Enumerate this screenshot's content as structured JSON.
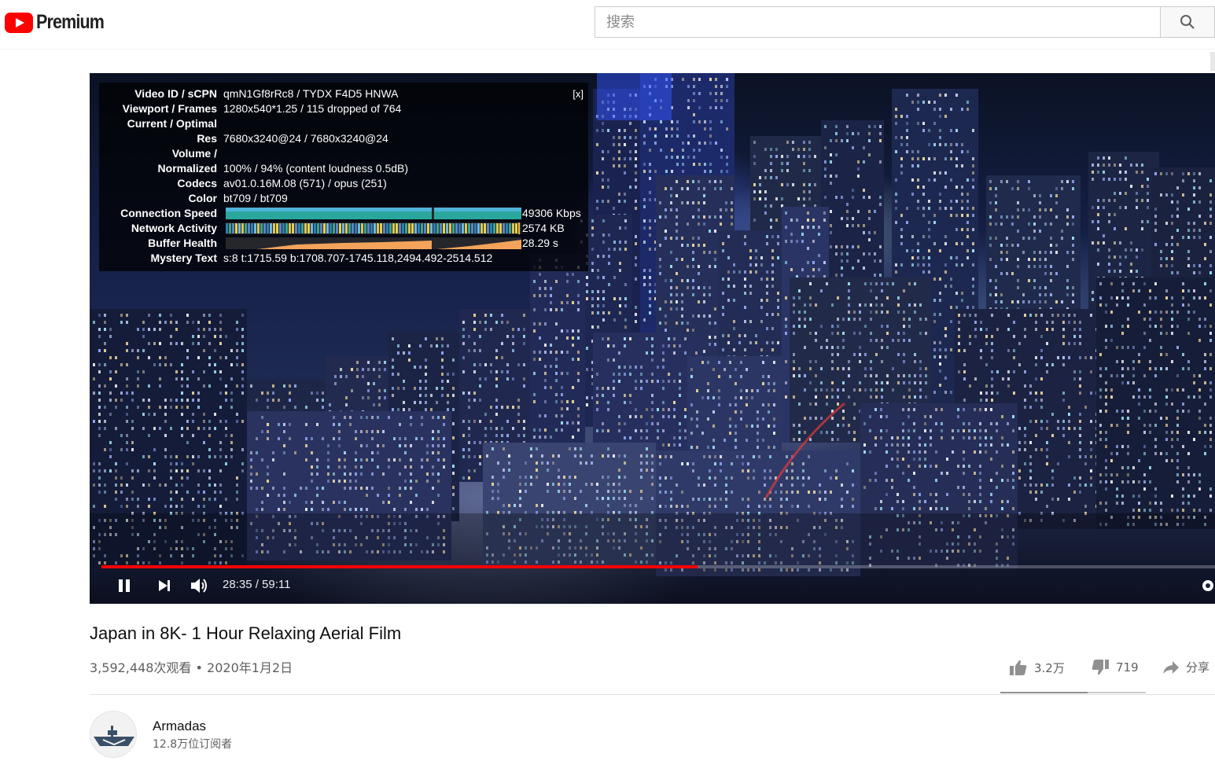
{
  "masthead": {
    "logo_text": "Premium",
    "search_placeholder": "搜索"
  },
  "player": {
    "stats": {
      "close_label": "[x]",
      "rows": [
        {
          "label": "Video ID / sCPN",
          "value": "qmN1Gf8rRc8 / TYDX F4D5 HNWA"
        },
        {
          "label": "Viewport / Frames",
          "value": "1280x540*1.25 / 115 dropped of 764"
        },
        {
          "label": "Current / Optimal",
          "value": ""
        },
        {
          "label": "Res",
          "value": "7680x3240@24 / 7680x3240@24"
        },
        {
          "label": "Volume /",
          "value": ""
        },
        {
          "label": "Normalized",
          "value": "100% / 94% (content loudness 0.5dB)"
        },
        {
          "label": "Codecs",
          "value": "av01.0.16M.08 (571) / opus (251)"
        },
        {
          "label": "Color",
          "value": "bt709 / bt709"
        },
        {
          "label": "Connection Speed",
          "value": "49306 Kbps"
        },
        {
          "label": "Network Activity",
          "value": "2574 KB"
        },
        {
          "label": "Buffer Health",
          "value": "28.29 s"
        },
        {
          "label": "Mystery Text",
          "value": "s:8 t:1715.59 b:1708.707-1745.118,2494.492-2514.512"
        }
      ]
    },
    "progress_fraction": 0.535,
    "time_display": "28:35 / 59:11",
    "accent_color": "#ff0000"
  },
  "video": {
    "title": "Japan in 8K- 1 Hour Relaxing Aerial Film",
    "meta": "3,592,448次观看 • 2020年1月2日",
    "likes": "3.2万",
    "dislikes": "719",
    "share_label": "分享"
  },
  "channel": {
    "name": "Armadas",
    "subscribers": "12.8万位订阅者"
  },
  "icons": [
    "youtube-logo-icon",
    "search-icon",
    "pause-icon",
    "next-icon",
    "volume-icon",
    "settings-icon",
    "thumbs-up-icon",
    "thumbs-down-icon",
    "share-icon"
  ]
}
